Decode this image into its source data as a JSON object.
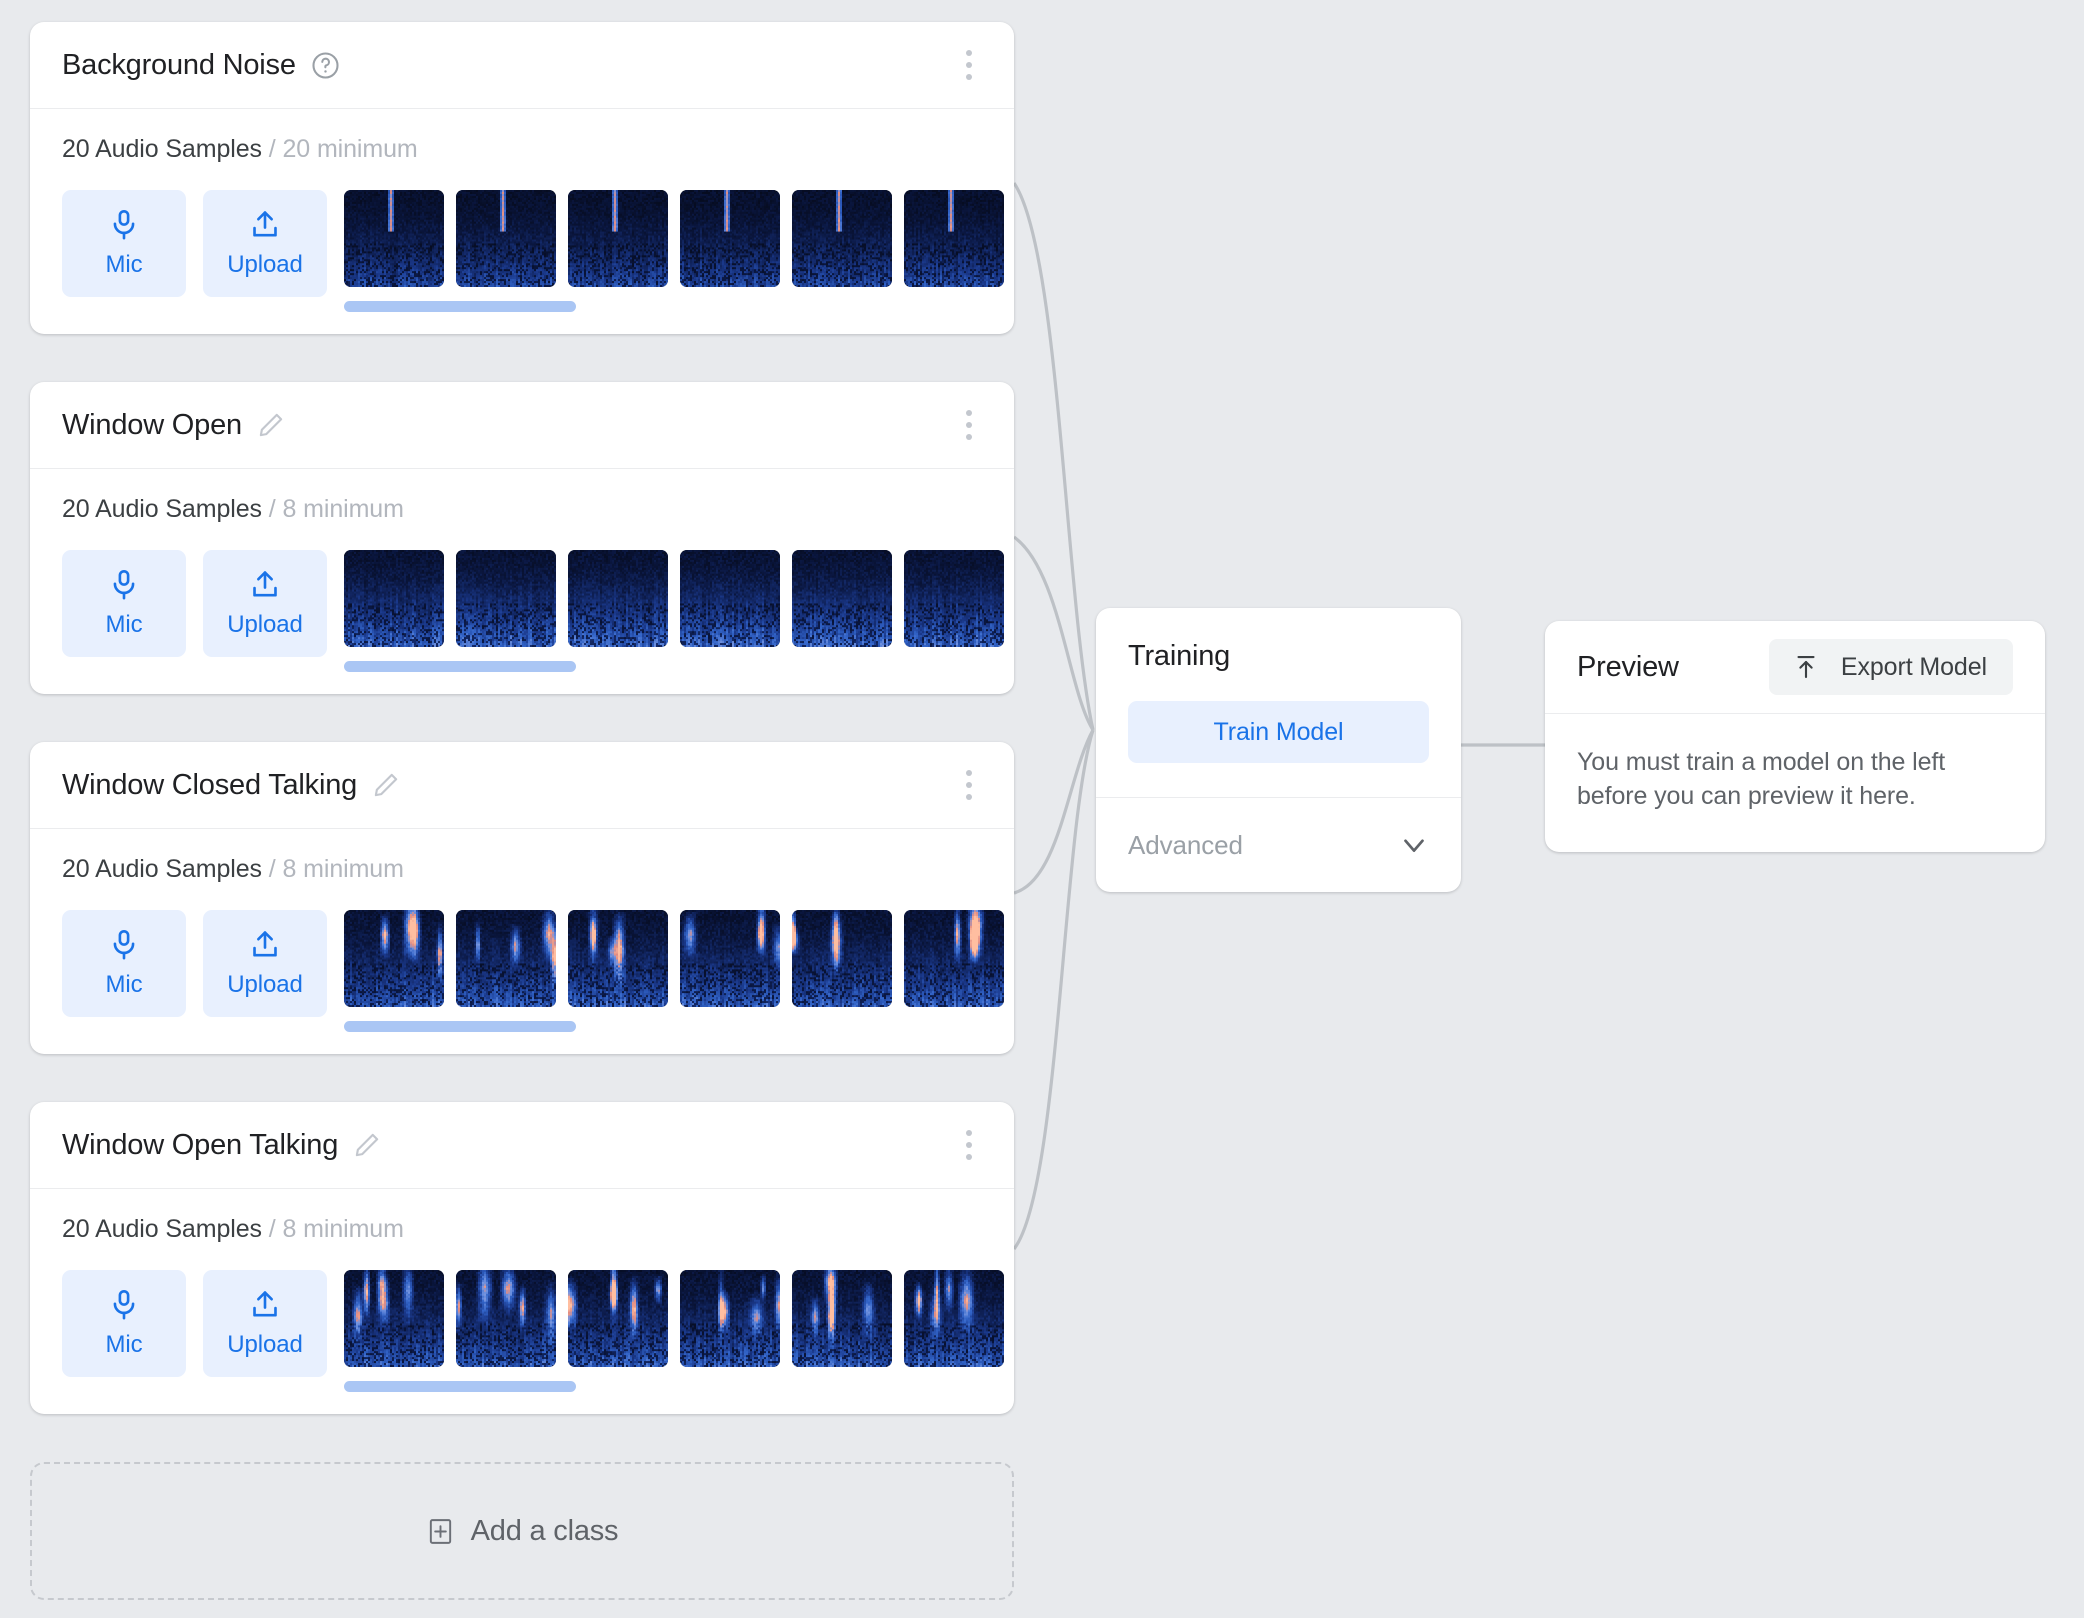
{
  "theme": {
    "page_background": "#e8eaed",
    "card_background": "#ffffff",
    "accent_blue": "#1a73e8",
    "accent_blue_soft": "#e8f0fe",
    "scrollbar_thumb": "#aac6f4",
    "muted_text": "#b2b6bd",
    "connector_line": "#bdc1c6"
  },
  "classes": [
    {
      "title": "Background Noise",
      "title_icon": "help-circle-icon",
      "samples_count": "20 Audio Samples",
      "samples_minimum": "/ 20 minimum",
      "mic_label": "Mic",
      "mic_icon": "microphone-icon",
      "upload_label": "Upload",
      "upload_icon": "upload-icon",
      "menu_icon": "more-vertical-icon",
      "thumbnail_count": 7,
      "spectrogram_style": "noise",
      "scroll_thumb_width": 232
    },
    {
      "title": "Window Open",
      "title_icon": "pencil-edit-icon",
      "samples_count": "20 Audio Samples",
      "samples_minimum": "/ 8 minimum",
      "mic_label": "Mic",
      "mic_icon": "microphone-icon",
      "upload_label": "Upload",
      "upload_icon": "upload-icon",
      "menu_icon": "more-vertical-icon",
      "thumbnail_count": 7,
      "spectrogram_style": "wind",
      "scroll_thumb_width": 232
    },
    {
      "title": "Window Closed Talking",
      "title_icon": "pencil-edit-icon",
      "samples_count": "20 Audio Samples",
      "samples_minimum": "/ 8 minimum",
      "mic_label": "Mic",
      "mic_icon": "microphone-icon",
      "upload_label": "Upload",
      "upload_icon": "upload-icon",
      "menu_icon": "more-vertical-icon",
      "thumbnail_count": 7,
      "spectrogram_style": "speech",
      "scroll_thumb_width": 232
    },
    {
      "title": "Window Open Talking",
      "title_icon": "pencil-edit-icon",
      "samples_count": "20 Audio Samples",
      "samples_minimum": "/ 8 minimum",
      "mic_label": "Mic",
      "mic_icon": "microphone-icon",
      "upload_label": "Upload",
      "upload_icon": "upload-icon",
      "menu_icon": "more-vertical-icon",
      "thumbnail_count": 7,
      "spectrogram_style": "speech-loud",
      "scroll_thumb_width": 232
    }
  ],
  "add_class": {
    "label": "Add a class",
    "icon": "plus-box-icon"
  },
  "training": {
    "title": "Training",
    "train_button_label": "Train Model",
    "advanced_label": "Advanced",
    "advanced_chevron_icon": "chevron-down-icon"
  },
  "preview": {
    "title": "Preview",
    "export_button_label": "Export Model",
    "export_icon": "export-upload-icon",
    "empty_message": "You must train a model on the left before you can preview it here."
  }
}
